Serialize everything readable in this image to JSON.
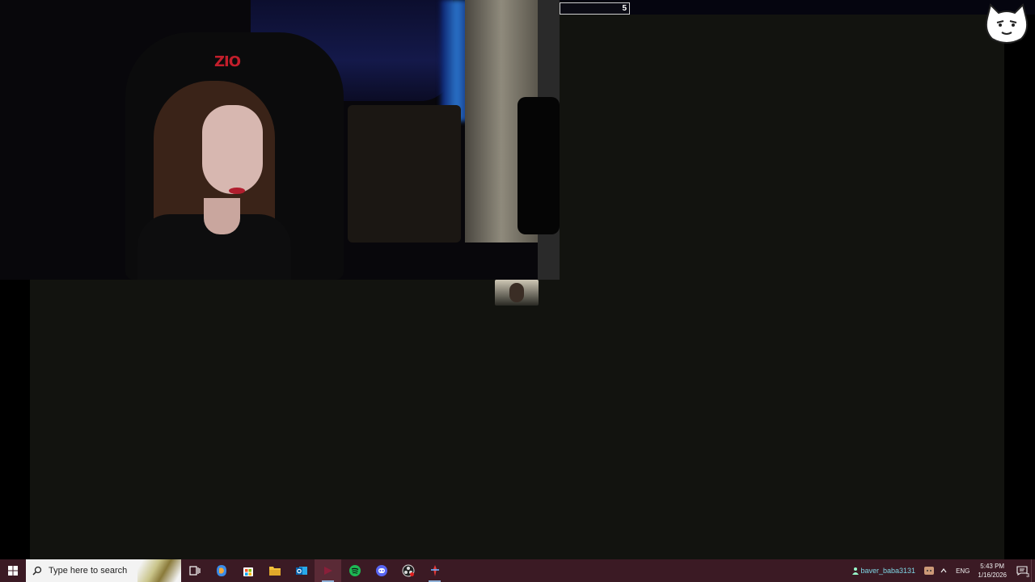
{
  "overlay": {
    "counter_value": "5",
    "webcam_logo_text": "ZIO"
  },
  "taskbar": {
    "search_placeholder": "Type here to search",
    "pinned_apps": [
      {
        "name": "task-view-icon"
      },
      {
        "name": "copilot-icon"
      },
      {
        "name": "store-icon"
      },
      {
        "name": "file-explorer-icon"
      },
      {
        "name": "outlook-icon"
      },
      {
        "name": "streaming-app-icon"
      },
      {
        "name": "spotify-icon"
      },
      {
        "name": "discord-icon"
      },
      {
        "name": "obs-icon"
      },
      {
        "name": "game-app-icon"
      }
    ],
    "tray": {
      "username": "baver_baba3131",
      "language": "ENG",
      "time": "5:43 PM",
      "date": "1/16/2026",
      "notification_count": "3"
    }
  },
  "colors": {
    "taskbar_bg": "#3b1a24",
    "desktop_bg": "#12130f",
    "spotify_green": "#1db954",
    "discord_purple": "#5865f2"
  }
}
